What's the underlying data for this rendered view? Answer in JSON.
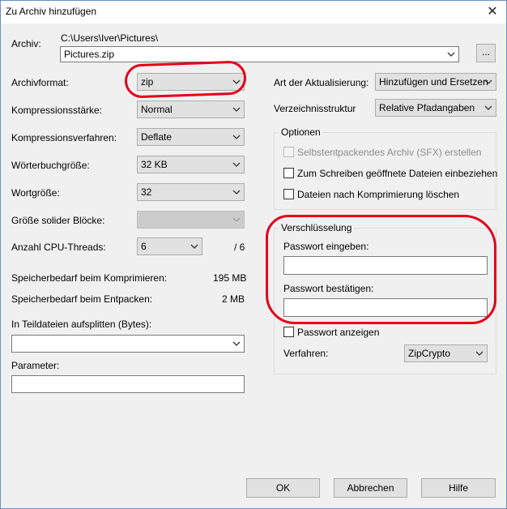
{
  "window": {
    "title": "Zu Archiv hinzufügen"
  },
  "archive": {
    "label": "Archiv:",
    "path": "C:\\Users\\Iver\\Pictures\\",
    "filename": "Pictures.zip",
    "browse_label": "..."
  },
  "left": {
    "format_label": "Archivformat:",
    "format_value": "zip",
    "level_label": "Kompressionsstärke:",
    "level_value": "Normal",
    "method_label": "Kompressionsverfahren:",
    "method_value": "Deflate",
    "dict_label": "Wörterbuchgröße:",
    "dict_value": "32 KB",
    "word_label": "Wortgröße:",
    "word_value": "32",
    "solid_label": "Größe solider Blöcke:",
    "solid_value": "",
    "threads_label": "Anzahl CPU-Threads:",
    "threads_value": "6",
    "threads_max": "/ 6",
    "mem_comp_label": "Speicherbedarf beim Komprimieren:",
    "mem_comp_value": "195 MB",
    "mem_decomp_label": "Speicherbedarf beim Entpacken:",
    "mem_decomp_value": "2 MB",
    "split_label": "In Teildateien aufsplitten (Bytes):",
    "split_value": "",
    "params_label": "Parameter:",
    "params_value": ""
  },
  "right": {
    "update_label": "Art der Aktualisierung:",
    "update_value": "Hinzufügen und Ersetzen",
    "pathmode_label": "Verzeichnisstruktur",
    "pathmode_value": "Relative Pfadangaben",
    "options": {
      "title": "Optionen",
      "sfx": "Selbstentpackendes Archiv (SFX) erstellen",
      "shared": "Zum Schreiben geöffnete Dateien einbeziehen",
      "delete": "Dateien nach Komprimierung löschen"
    },
    "encryption": {
      "title": "Verschlüsselung",
      "pw_label": "Passwort eingeben:",
      "pw_value": "",
      "pw_confirm_label": "Passwort bestätigen:",
      "pw_confirm_value": "",
      "show_pw": "Passwort anzeigen",
      "method_label": "Verfahren:",
      "method_value": "ZipCrypto"
    }
  },
  "buttons": {
    "ok": "OK",
    "cancel": "Abbrechen",
    "help": "Hilfe"
  },
  "colors": {
    "annotation": "#e3001b",
    "window_border": "#6b8fc7"
  }
}
